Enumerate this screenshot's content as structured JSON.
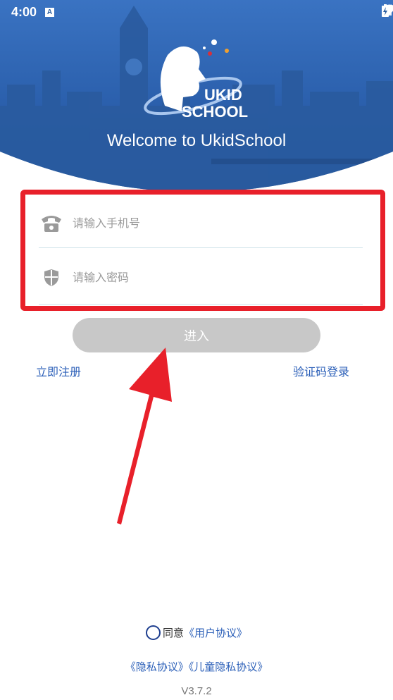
{
  "status_bar": {
    "time": "4:00",
    "notification_letter": "A",
    "icons": [
      "wifi-icon",
      "signal-icon",
      "battery-charging-icon"
    ]
  },
  "header": {
    "logo_text_top": "UKID",
    "logo_text_bottom": "SCHOOL",
    "welcome": "Welcome to UkidSchool",
    "colors": {
      "sky": "#2c63b0",
      "logo_red": "#d8303a",
      "logo_blue": "#1f3f8f"
    }
  },
  "form": {
    "phone_placeholder": "请输入手机号",
    "password_placeholder": "请输入密码",
    "phone_icon": "telephone-icon",
    "password_icon": "shield-icon",
    "highlight_color": "#e8202a"
  },
  "actions": {
    "enter_label": "进入",
    "register_label": "立即注册",
    "sms_login_label": "验证码登录"
  },
  "footer": {
    "agree_text": "同意",
    "user_agreement": "《用户协议》",
    "privacy_policy": "《隐私协议》",
    "child_privacy_policy": "《儿童隐私协议》",
    "version": "V3.7.2"
  }
}
